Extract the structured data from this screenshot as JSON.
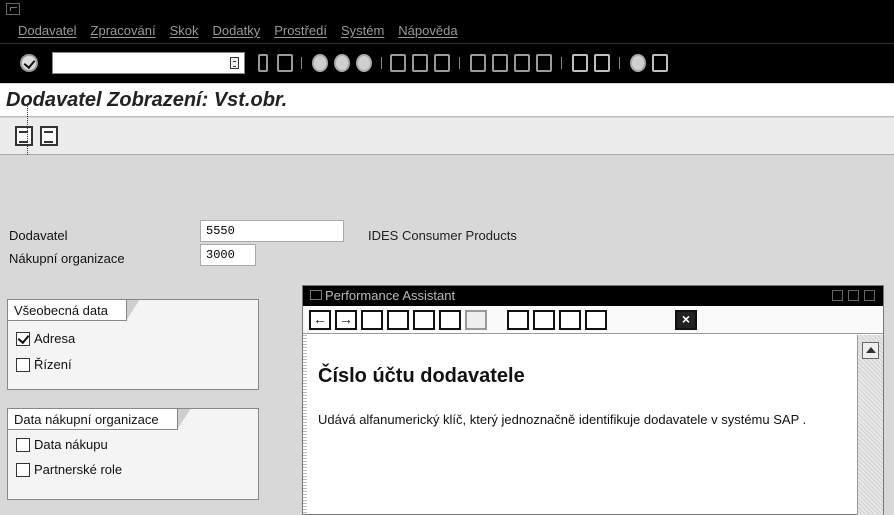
{
  "menubar": {
    "items": [
      "Dodavatel",
      "Zpracování",
      "Skok",
      "Dodatky",
      "Prostředí",
      "Systém",
      "Nápověda"
    ]
  },
  "toolbar": {
    "command_value": "",
    "icons": [
      "enter-icon",
      "back-icon",
      "save-icon",
      "green-back-icon",
      "exit-icon",
      "cancel-icon",
      "print-icon",
      "find-icon",
      "find-next-icon",
      "first-page-icon",
      "prev-page-icon",
      "next-page-icon",
      "last-page-icon",
      "new-session-icon",
      "shortcut-icon",
      "help-icon",
      "layout-icon"
    ]
  },
  "title": "Dodavatel Zobrazení: Vst.obr.",
  "app_toolbar": {
    "icons": [
      "display-icon",
      "overview-icon"
    ]
  },
  "fields": {
    "vendor_label": "Dodavatel",
    "vendor_value": "5550",
    "vendor_desc": "IDES Consumer Products",
    "purch_org_label": "Nákupní organizace",
    "purch_org_value": "3000"
  },
  "group_general": {
    "title": "Všeobecná data",
    "items": [
      {
        "label": "Adresa",
        "checked": true
      },
      {
        "label": "Řízení",
        "checked": false
      }
    ]
  },
  "group_purch": {
    "title": "Data nákupní organizace",
    "items": [
      {
        "label": "Data nákupu",
        "checked": false
      },
      {
        "label": "Partnerské role",
        "checked": false
      }
    ]
  },
  "performance_assistant": {
    "title": "Performance Assistant",
    "heading": "Číslo účtu dodavatele",
    "body": "Udává alfanumerický klíč, který jednoznačně identifikuje dodavatele v systému SAP .",
    "toolbar_icons": [
      "back-arrow-icon",
      "forward-arrow-icon",
      "technical-info-icon",
      "field-doc-icon",
      "edit-icon",
      "add-note-icon",
      "disabled-icon",
      "library-icon",
      "tag-icon",
      "print-preview-icon",
      "print-icon",
      "close-icon"
    ]
  }
}
